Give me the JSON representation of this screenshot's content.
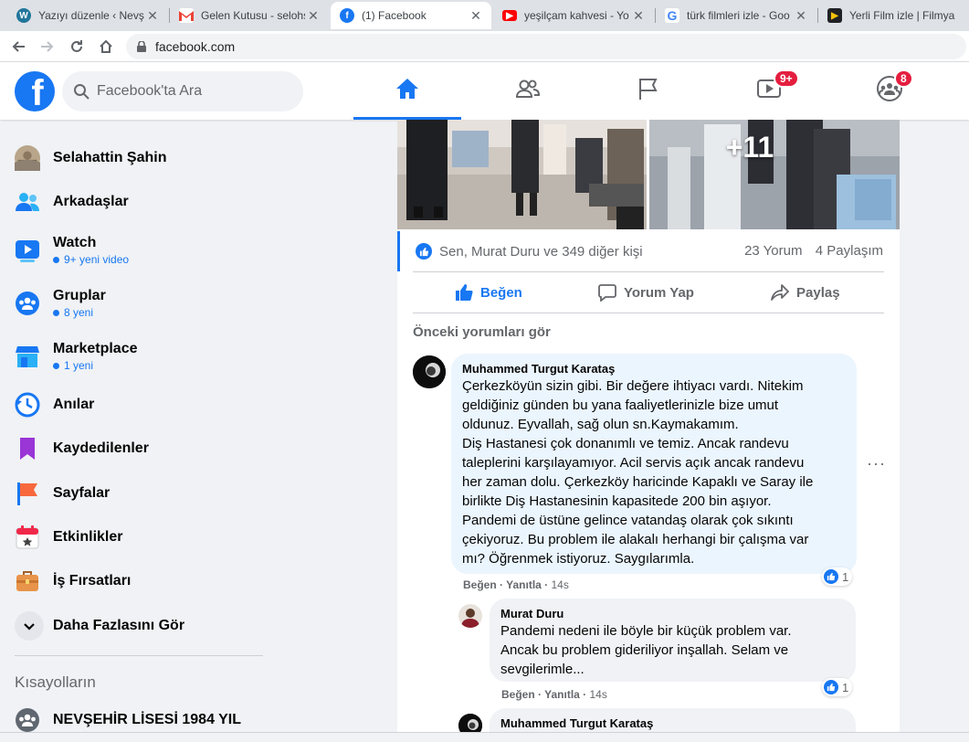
{
  "browser": {
    "tabs": [
      {
        "title": "Yazıyı düzenle ‹ Nevş",
        "icon": "wordpress-icon",
        "color": "#21759b"
      },
      {
        "title": "Gelen Kutusu - selohs",
        "icon": "gmail-icon",
        "color": "#ea4335"
      },
      {
        "title": "(1) Facebook",
        "icon": "facebook-icon",
        "color": "#1877f2"
      },
      {
        "title": "yeşilçam kahvesi - Yo",
        "icon": "youtube-icon",
        "color": "#ff0000"
      },
      {
        "title": "türk filmleri izle - Goo",
        "icon": "google-icon",
        "color": "#4285f4"
      },
      {
        "title": "Yerli Film izle | Filmya",
        "icon": "play-icon",
        "color": "#202124"
      }
    ],
    "url": "facebook.com"
  },
  "header": {
    "search_placeholder": "Facebook'ta Ara",
    "logo": "f",
    "badges": {
      "watch": "9+",
      "groups": "8"
    }
  },
  "sidebar": {
    "items": [
      {
        "label": "Selahattin Şahin",
        "icon": "profile-avatar"
      },
      {
        "label": "Arkadaşlar",
        "icon": "friends-icon"
      },
      {
        "label": "Watch",
        "sub": "9+ yeni video",
        "icon": "watch-icon"
      },
      {
        "label": "Gruplar",
        "sub": "8 yeni",
        "icon": "groups-icon"
      },
      {
        "label": "Marketplace",
        "sub": "1 yeni",
        "icon": "marketplace-icon"
      },
      {
        "label": "Anılar",
        "icon": "memories-icon"
      },
      {
        "label": "Kaydedilenler",
        "icon": "saved-icon"
      },
      {
        "label": "Sayfalar",
        "icon": "pages-icon"
      },
      {
        "label": "Etkinlikler",
        "icon": "events-icon"
      },
      {
        "label": "İş Fırsatları",
        "icon": "jobs-icon"
      },
      {
        "label": "Daha Fazlasını Gör",
        "icon": "chevron-down-icon"
      }
    ],
    "shortcuts_title": "Kısayolların",
    "shortcuts": [
      {
        "label": "NEVŞEHİR LİSESİ 1984 YIL",
        "icon": "group-icon"
      }
    ]
  },
  "post": {
    "more_photos": "+11",
    "reactions_text": "Sen, Murat Duru ve 349 diğer kişi",
    "comments_count": "23 Yorum",
    "shares_count": "4 Paylaşım",
    "actions": {
      "like": "Beğen",
      "comment": "Yorum Yap",
      "share": "Paylaş"
    },
    "previous_comments": "Önceki yorumları gör",
    "comments": [
      {
        "author": "Muhammed Turgut Karataş",
        "text": "Çerkezköyün sizin gibi. Bir değere ihtiyacı vardı. Nitekim\ngeldiğiniz günden bu yana faaliyetlerinizle bize umut\noldunuz. Eyvallah, sağ olun sn.Kaymakamım.\nDiş Hastanesi çok donanımlı ve temiz. Ancak randevu\ntaleplerini karşılayamıyor. Acil servis açık ancak randevu\nher zaman dolu. Çerkezköy haricinde Kapaklı ve Saray ile\nbirlikte Diş Hastanesinin kapasitede 200 bin aşıyor.\nPandemi de üstüne gelince vatandaş olarak çok sıkıntı\nçekiyoruz. Bu problem ile alakalı herhangi bir çalışma var\nmı? Öğrenmek istiyoruz. Saygılarımla.",
        "like": "Beğen",
        "reply": "Yanıtla",
        "time": "14s",
        "reactions": "1"
      },
      {
        "author": "Murat Duru",
        "text": "Pandemi nedeni ile böyle bir küçük problem var.\nAncak bu problem gideriliyor inşallah. Selam ve\nsevgilerimle...",
        "like": "Beğen",
        "reply": "Yanıtla",
        "time": "14s",
        "reactions": "1"
      },
      {
        "author": "Muhammed Turgut Karataş"
      }
    ],
    "more_options": "···"
  }
}
